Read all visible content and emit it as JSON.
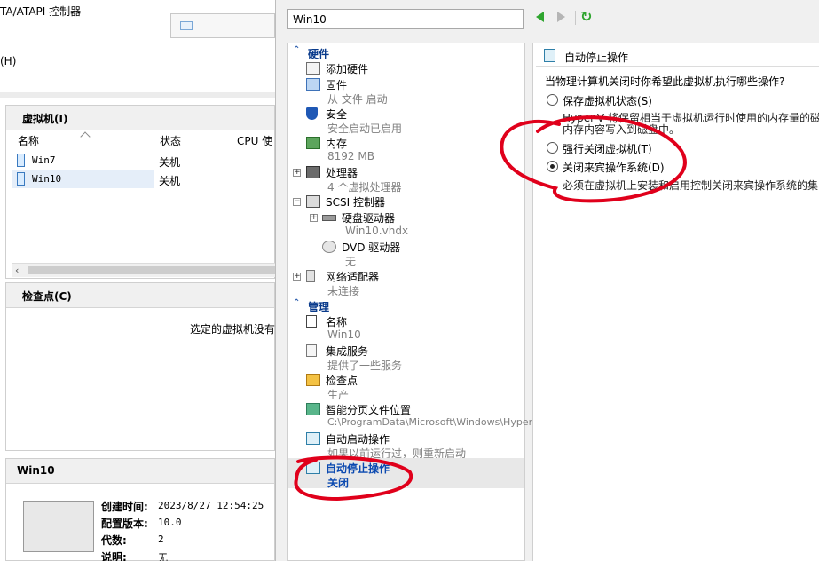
{
  "background_window": {
    "title_fragment": "TA/ATAPI 控制器",
    "menu_fragment": "(H)",
    "vm_panel": {
      "title": "虚拟机(I)",
      "columns": [
        "名称",
        "状态",
        "CPU 使"
      ],
      "rows": [
        {
          "name": "Win7",
          "state": "关机",
          "selected": false
        },
        {
          "name": "Win10",
          "state": "关机",
          "selected": true
        }
      ]
    },
    "checkpoint_panel": {
      "title": "检查点(C)",
      "empty_text": "选定的虚拟机没有"
    },
    "detail_panel": {
      "title": "Win10",
      "fields": [
        {
          "label": "创建时间:",
          "value": "2023/8/27 12:54:25"
        },
        {
          "label": "配置版本:",
          "value": "10.0"
        },
        {
          "label": "代数:",
          "value": "2"
        },
        {
          "label": "说明:",
          "value": "无"
        }
      ]
    }
  },
  "dialog": {
    "vm_selector": {
      "value": "Win10"
    },
    "sections": {
      "hardware": "硬件",
      "management": "管理"
    },
    "hardware_items": [
      {
        "key": "add_hardware",
        "label": "添加硬件",
        "sub": "",
        "icon": "add-hardware-icon"
      },
      {
        "key": "firmware",
        "label": "固件",
        "sub": "从 文件 启动",
        "icon": "firmware-icon"
      },
      {
        "key": "security",
        "label": "安全",
        "sub": "安全启动已启用",
        "icon": "shield-icon"
      },
      {
        "key": "memory",
        "label": "内存",
        "sub": "8192 MB",
        "icon": "memory-icon"
      },
      {
        "key": "processor",
        "label": "处理器",
        "sub": "4 个虚拟处理器",
        "icon": "processor-icon"
      },
      {
        "key": "scsi",
        "label": "SCSI 控制器",
        "sub": "",
        "icon": "scsi-icon"
      },
      {
        "key": "hard_drive",
        "label": "硬盘驱动器",
        "sub": "Win10.vhdx",
        "icon": "hard-drive-icon"
      },
      {
        "key": "dvd",
        "label": "DVD 驱动器",
        "sub": "无",
        "icon": "dvd-icon"
      },
      {
        "key": "network",
        "label": "网络适配器",
        "sub": "未连接",
        "icon": "network-adapter-icon"
      }
    ],
    "management_items": [
      {
        "key": "name",
        "label": "名称",
        "sub": "Win10",
        "icon": "name-icon"
      },
      {
        "key": "integration",
        "label": "集成服务",
        "sub": "提供了一些服务",
        "icon": "integration-services-icon"
      },
      {
        "key": "checkpoints",
        "label": "检查点",
        "sub": "生产",
        "icon": "checkpoint-icon"
      },
      {
        "key": "paging",
        "label": "智能分页文件位置",
        "sub": "C:\\ProgramData\\Microsoft\\Windows\\Hyper-V",
        "icon": "paging-file-icon"
      },
      {
        "key": "auto_start",
        "label": "自动启动操作",
        "sub": "如果以前运行过，则重新启动",
        "icon": "auto-start-icon"
      },
      {
        "key": "auto_stop",
        "label": "自动停止操作",
        "sub": "关闭",
        "icon": "auto-stop-icon",
        "selected": true
      }
    ],
    "right_pane": {
      "title": "自动停止操作",
      "question": "当物理计算机关闭时你希望此虚拟机执行哪些操作?",
      "options": [
        {
          "label": "保存虚拟机状态(S)",
          "checked": false
        },
        {
          "label": "强行关闭虚拟机(T)",
          "checked": false
        },
        {
          "label": "关闭来宾操作系统(D)",
          "checked": true
        }
      ],
      "save_desc_line1": "Hyper-V 将保留相当于虚拟机运行时使用的内存量的磁盘",
      "save_desc_line2": "内存内容写入到磁盘中。",
      "shutdown_desc": "必须在虚拟机上安装和启用控制关闭来宾操作系统的集"
    },
    "annotation_color": "#e0001b"
  }
}
